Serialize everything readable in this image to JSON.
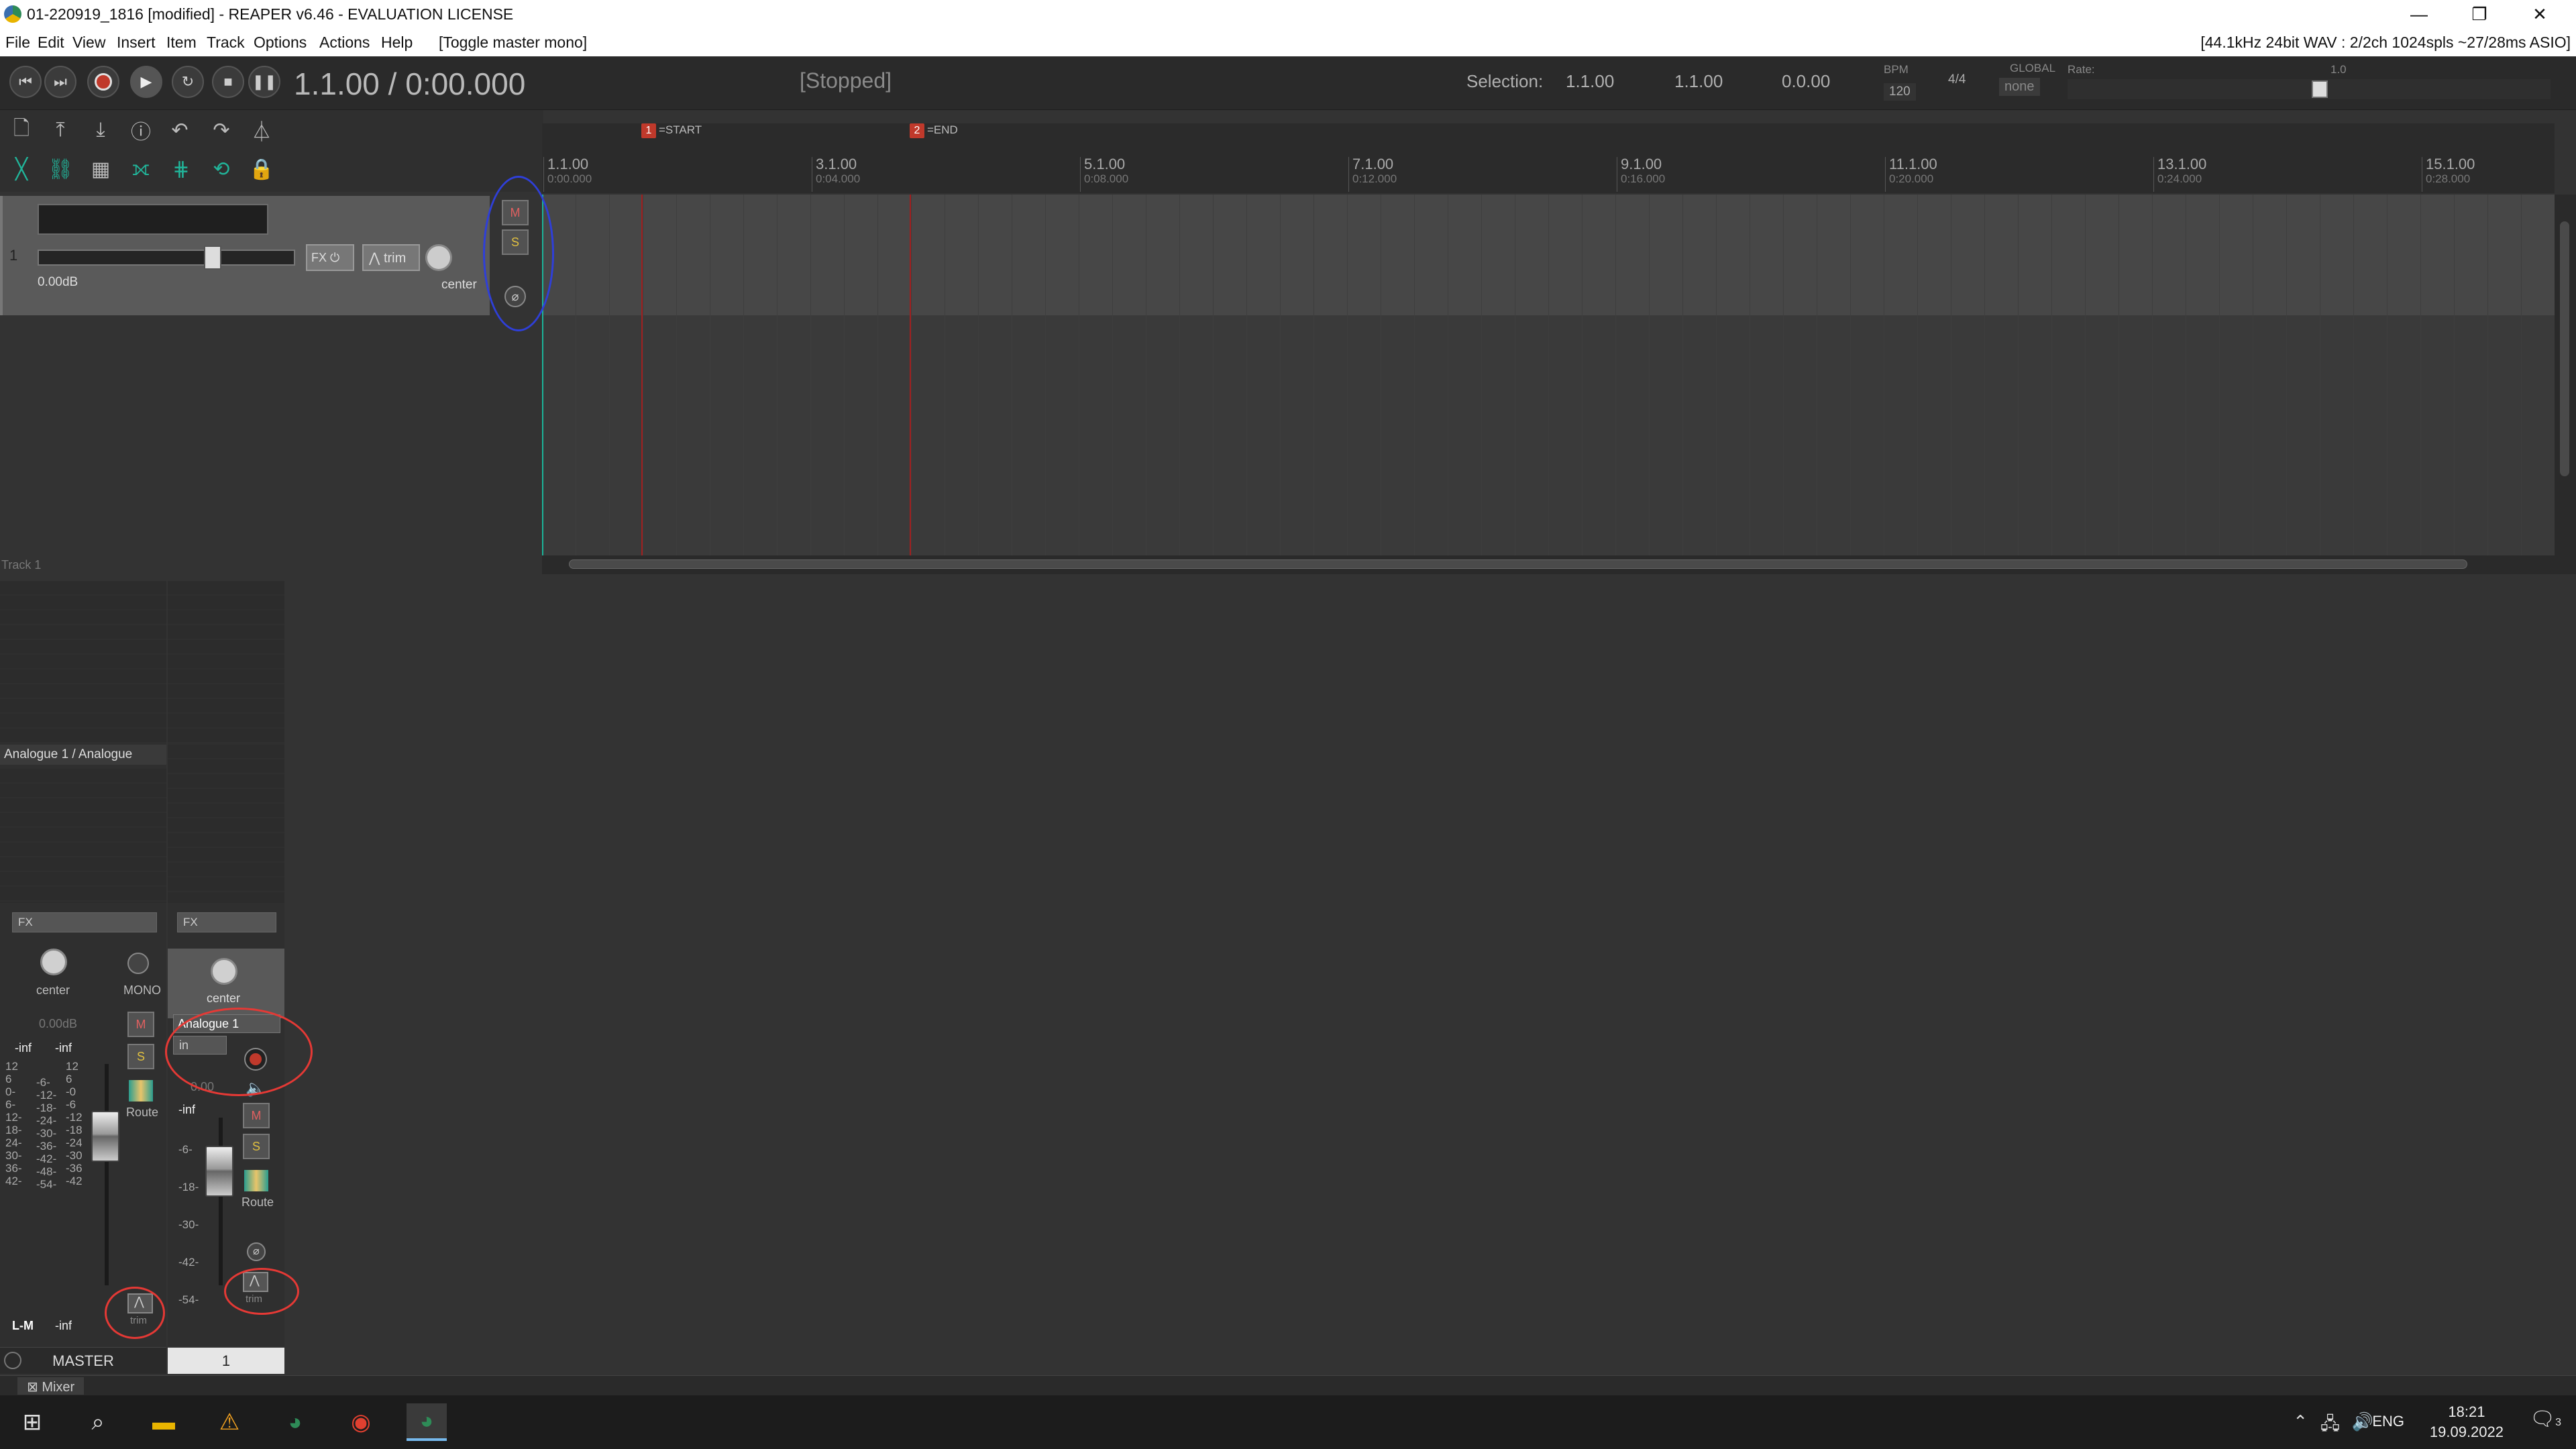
{
  "window": {
    "title": "01-220919_1816 [modified] - REAPER v6.46 - EVALUATION LICENSE",
    "controls": [
      "—",
      "❐",
      "✕"
    ]
  },
  "menu": {
    "items": [
      "File",
      "Edit",
      "View",
      "Insert",
      "Item",
      "Track",
      "Options",
      "Actions",
      "Help",
      "[Toggle master mono]"
    ],
    "status": "[44.1kHz 24bit WAV : 2/2ch 1024spls ~27/28ms ASIO]"
  },
  "transport": {
    "position": "1.1.00 / 0:00.000",
    "state": "[Stopped]",
    "selection_label": "Selection:",
    "selection_start": "1.1.00",
    "selection_end": "1.1.00",
    "selection_length": "0.0.00",
    "bpm_label": "BPM",
    "bpm": "120",
    "timesig": "4/4",
    "global_label": "GLOBAL",
    "global_value": "none",
    "rate_label": "Rate:",
    "rate_value": "1.0"
  },
  "ruler": {
    "markers": [
      {
        "num": "1",
        "label": "=START"
      },
      {
        "num": "2",
        "label": "=END"
      }
    ],
    "bars": [
      {
        "bar": "1.1.00",
        "time": "0:00.000"
      },
      {
        "bar": "3.1.00",
        "time": "0:04.000"
      },
      {
        "bar": "5.1.00",
        "time": "0:08.000"
      },
      {
        "bar": "7.1.00",
        "time": "0:12.000"
      },
      {
        "bar": "9.1.00",
        "time": "0:16.000"
      },
      {
        "bar": "11.1.00",
        "time": "0:20.000"
      },
      {
        "bar": "13.1.00",
        "time": "0:24.000"
      },
      {
        "bar": "15.1.00",
        "time": "0:28.000"
      }
    ]
  },
  "tcp": {
    "track_number": "1",
    "volume": "0.00dB",
    "fx": "FX",
    "trim": "trim",
    "pan": "center",
    "mute": "M",
    "solo": "S",
    "phase": "⌀"
  },
  "mixer": {
    "track_label": "Track 1",
    "master": {
      "io": "Analogue 1 / Analogue",
      "fx": "FX",
      "pan": "center",
      "mono": "MONO",
      "volume": "0.00dB",
      "peak_l": "-inf",
      "peak_r": "-inf",
      "mute": "M",
      "solo": "S",
      "route": "Route",
      "trim": "trim",
      "channel_mode": "L-M",
      "lufs": "-inf",
      "name": "MASTER",
      "scale_left": [
        "12",
        "6",
        "0-",
        "6-",
        "12-",
        "18-",
        "24-",
        "30-",
        "36-",
        "42-"
      ],
      "scale_mid": [
        "-6-",
        "-12-",
        "-18-",
        "-24-",
        "-30-",
        "-36-",
        "-42-",
        "-48-",
        "-54-"
      ],
      "scale_right": [
        "12",
        "6",
        "-0",
        "-6",
        "-12",
        "-18",
        "-24",
        "-30",
        "-36",
        "-42"
      ]
    },
    "track1": {
      "fx": "FX",
      "pan": "center",
      "input": "Analogue 1",
      "in": "in",
      "volume": "0.00",
      "peak": "-inf",
      "mute": "M",
      "solo": "S",
      "route": "Route",
      "phase": "⌀",
      "trim": "trim",
      "name": "1",
      "scale": [
        "-6-",
        "-18-",
        "-30-",
        "-42-",
        "-54-"
      ]
    }
  },
  "docker": {
    "tab": "Mixer"
  },
  "taskbar": {
    "lang": "ENG",
    "time": "18:21",
    "date": "19.09.2022",
    "notif_count": "3"
  }
}
